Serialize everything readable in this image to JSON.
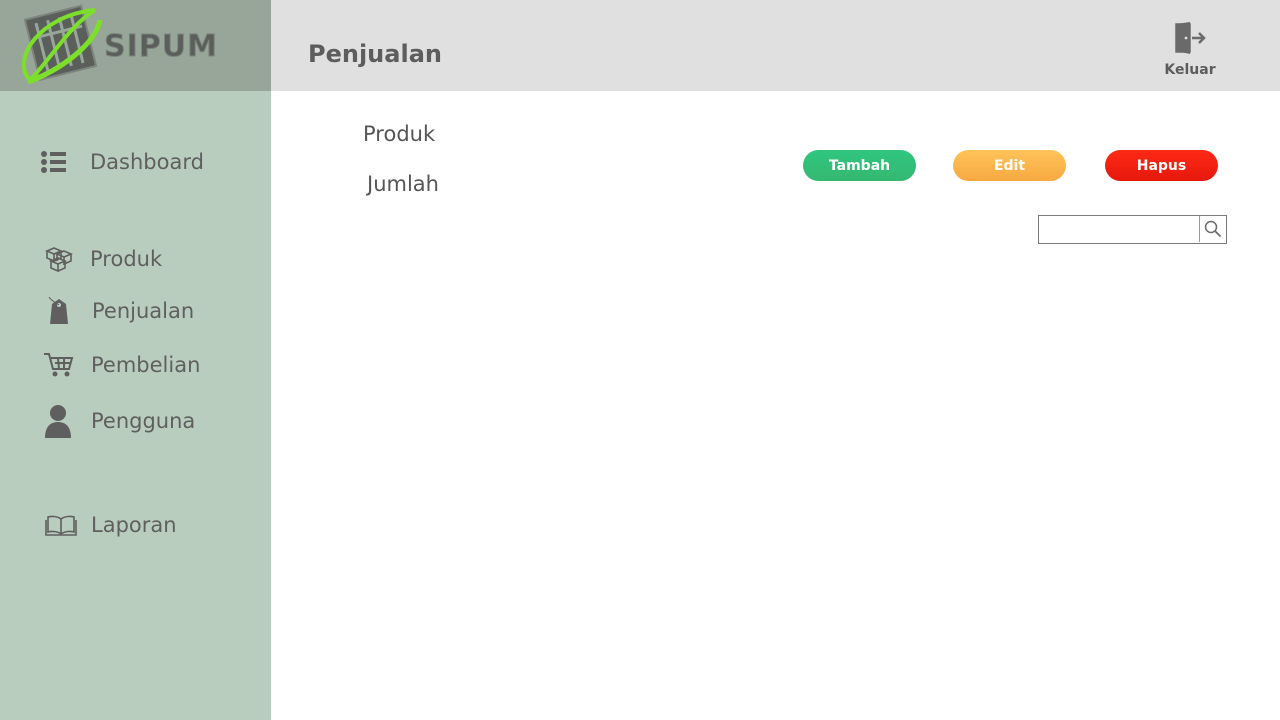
{
  "app": {
    "logo_text": "SIPUM"
  },
  "header": {
    "title": "Penjualan",
    "logout_label": "Keluar"
  },
  "sidebar": {
    "items": [
      {
        "label": "Dashboard",
        "icon": "list-icon"
      },
      {
        "label": "Produk",
        "icon": "boxes-icon"
      },
      {
        "label": "Penjualan",
        "icon": "price-tag-icon"
      },
      {
        "label": "Pembelian",
        "icon": "cart-icon"
      },
      {
        "label": "Pengguna",
        "icon": "user-icon"
      },
      {
        "label": "Laporan",
        "icon": "book-icon"
      }
    ]
  },
  "form": {
    "product_label": "Produk",
    "quantity_label": "Jumlah"
  },
  "actions": {
    "add_label": "Tambah",
    "edit_label": "Edit",
    "delete_label": "Hapus"
  },
  "search": {
    "value": "",
    "placeholder": ""
  },
  "colors": {
    "sidebar": "#b9cdbf",
    "logo_bg": "#97a699",
    "header": "#dfe0df",
    "add": "#35c477",
    "edit": "#fbb34c",
    "delete": "#f0170c",
    "text": "#5f5f5f"
  }
}
